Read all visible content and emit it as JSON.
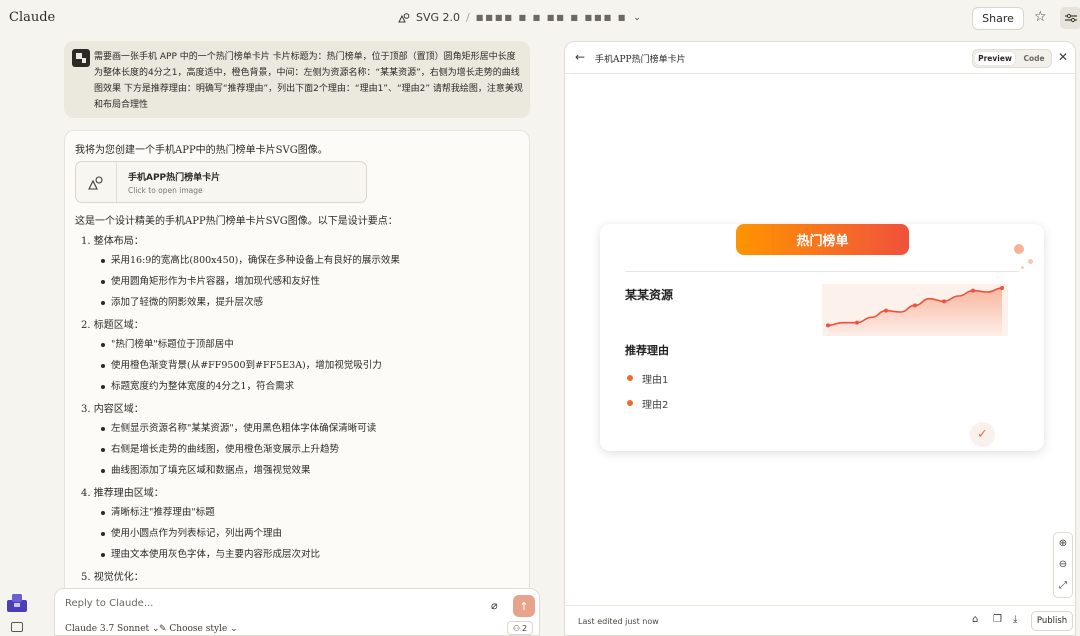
{
  "app": {
    "brand": "Claude"
  },
  "header": {
    "doc_title": "SVG 2.0",
    "doc_separator": "/",
    "project_name_obscured": "■■■■  ■ ■ ■■ ■  ■■■ ■",
    "share_label": "Share"
  },
  "user_message": {
    "text": "需要画一张手机 APP 中的一个热门榜单卡片 卡片标题为：热门榜单，位于顶部（置顶）圆角矩形居中长度为整体长度的4分之1，高度适中，橙色背景，中间：左侧为资源名称：“某某资源”，右侧为增长走势的曲线图效果 下方是推荐理由：明确写“推荐理由”，列出下面2个理由：“理由1”、“理由2” 请帮我绘图，注意美观和布局合理性"
  },
  "assistant": {
    "intro": "我将为您创建一个手机APP中的热门榜单卡片SVG图像。",
    "artifact": {
      "title": "手机APP热门榜单卡片",
      "subtitle": "Click to open image"
    },
    "summary": "这是一个设计精美的手机APP热门榜单卡片SVG图像。以下是设计要点：",
    "sections": [
      {
        "heading": "1. 整体布局：",
        "items": [
          "采用16:9的宽高比(800x450)，确保在多种设备上有良好的展示效果",
          "使用圆角矩形作为卡片容器，增加现代感和友好性",
          "添加了轻微的阴影效果，提升层次感"
        ]
      },
      {
        "heading": "2. 标题区域：",
        "items": [
          "\"热门榜单\"标题位于顶部居中",
          "使用橙色渐变背景(从#FF9500到#FF5E3A)，增加视觉吸引力",
          "标题宽度约为整体宽度的4分之1，符合需求"
        ]
      },
      {
        "heading": "3. 内容区域：",
        "items": [
          "左侧显示资源名称\"某某资源\"，使用黑色粗体字体确保清晰可读",
          "右侧是增长走势的曲线图，使用橙色渐变展示上升趋势",
          "曲线图添加了填充区域和数据点，增强视觉效果"
        ]
      },
      {
        "heading": "4. 推荐理由区域：",
        "items": [
          "清晰标注\"推荐理由\"标题",
          "使用小圆点作为列表标记，列出两个理由",
          "理由文本使用灰色字体，与主要内容形成层次对比"
        ]
      },
      {
        "heading": "5. 视觉优化：",
        "items": []
      }
    ]
  },
  "composer": {
    "placeholder": "Reply to Claude...",
    "model": "Claude 3.7 Sonnet ⌄",
    "style": "Choose style ⌄",
    "count": "2"
  },
  "panel": {
    "title": "手机APP热门榜单卡片",
    "tab_preview": "Preview",
    "tab_code": "Code",
    "footer_edited": "Last edited just now",
    "publish_label": "Publish"
  },
  "card": {
    "title": "热门榜单",
    "resource_name": "某某资源",
    "reason_heading": "推荐理由",
    "reasons": [
      "理由1",
      "理由2"
    ],
    "trend_values": [
      2,
      4,
      4,
      8,
      13,
      12,
      17,
      22,
      20,
      24,
      28,
      27,
      30
    ],
    "colors": {
      "gradient_start": "#FF9500",
      "gradient_end": "#FF5E3A",
      "dot": "#F26A28"
    }
  },
  "icons": {
    "star": "star-icon",
    "settings": "sliders-icon",
    "attach": "paperclip-icon",
    "send": "arrow-up-icon",
    "back": "arrow-left-icon",
    "close": "close-icon",
    "zoom_in": "zoom-in-icon",
    "zoom_out": "zoom-out-icon",
    "fit": "expand-icon",
    "copy": "clipboard-icon",
    "download": "download-icon",
    "check": "check-icon"
  }
}
